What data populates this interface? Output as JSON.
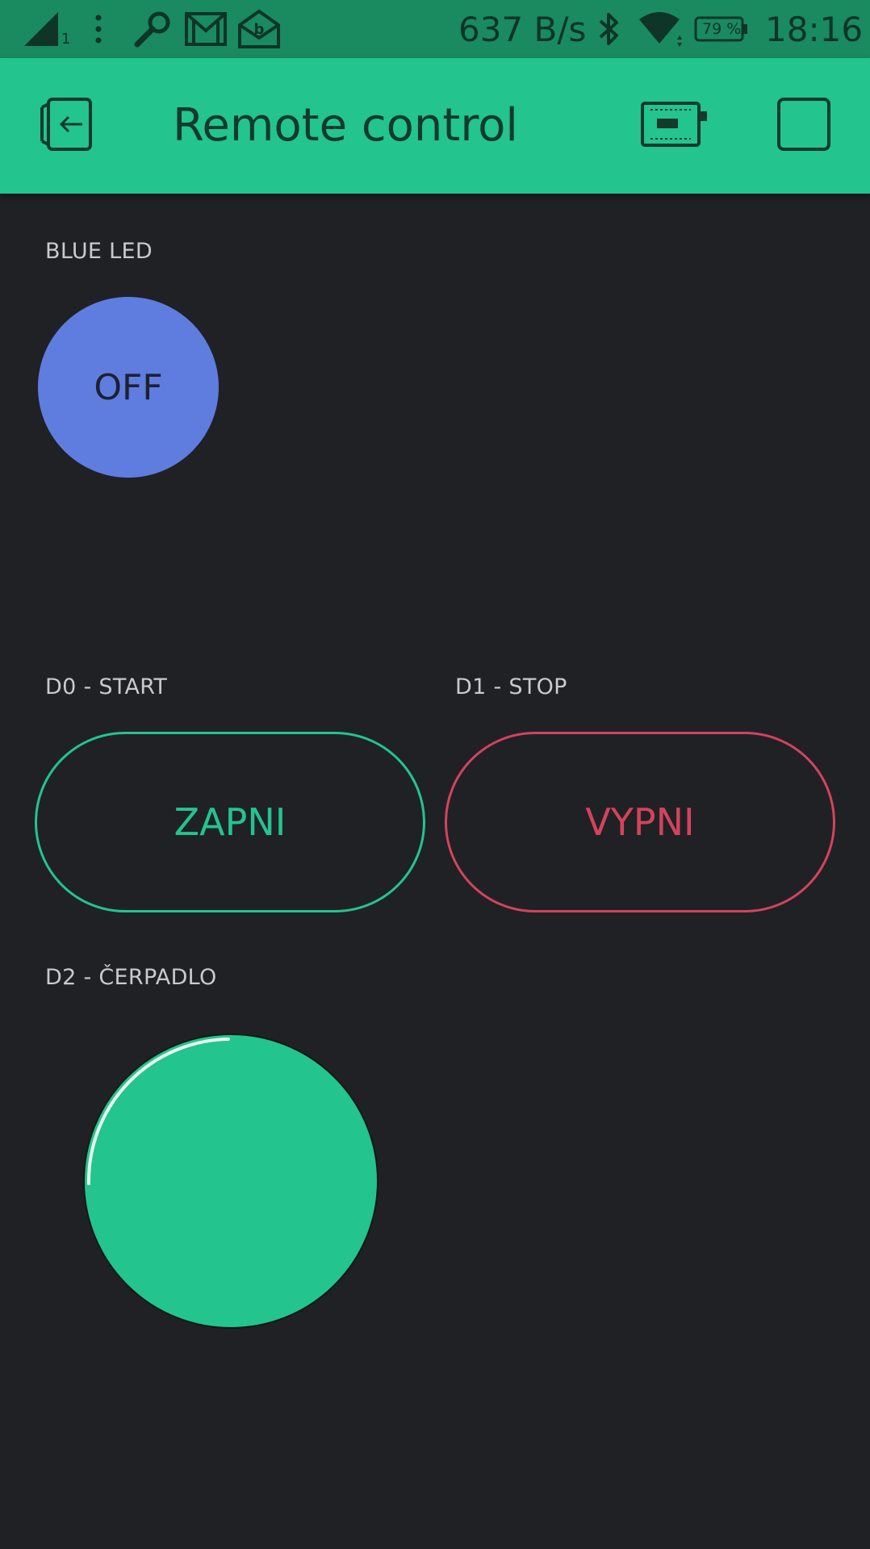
{
  "status_bar": {
    "network_speed": "637 B/s",
    "battery_percent": "79 %",
    "time": "18:16",
    "signal_sub": "1",
    "icons": [
      "signal-icon",
      "more-vert-icon",
      "wrench-icon",
      "gmail-icon",
      "email-icon",
      "bluetooth-icon",
      "wifi-icon",
      "battery-icon"
    ]
  },
  "app_bar": {
    "title": "Remote control",
    "icons": [
      "exit-icon",
      "device-icon",
      "stop-square-icon"
    ]
  },
  "widgets": {
    "blue_led": {
      "label": "BLUE LED",
      "button_text": "OFF",
      "color": "#5f7ddf"
    },
    "d0_start": {
      "label": "D0 - START",
      "button_text": "ZAPNI",
      "color": "#23c48e"
    },
    "d1_stop": {
      "label": "D1 - STOP",
      "button_text": "VYPNI",
      "color": "#d3435c"
    },
    "d2_pump": {
      "label": "D2 - ČERPADLO",
      "color": "#23c48e"
    }
  },
  "colors": {
    "background": "#202125",
    "accent": "#23c48e",
    "status_bar": "#1a8a60"
  }
}
